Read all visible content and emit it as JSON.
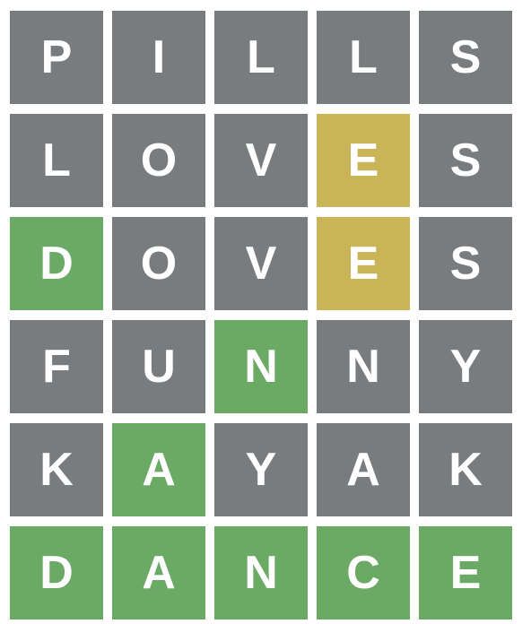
{
  "colors": {
    "absent": "#787c7e",
    "present": "#c9b458",
    "correct": "#6aaa64",
    "letter": "#ffffff",
    "background": "#ffffff"
  },
  "board": {
    "rows": [
      {
        "word": "PILLS",
        "tiles": [
          {
            "letter": "P",
            "state": "absent"
          },
          {
            "letter": "I",
            "state": "absent"
          },
          {
            "letter": "L",
            "state": "absent"
          },
          {
            "letter": "L",
            "state": "absent"
          },
          {
            "letter": "S",
            "state": "absent"
          }
        ]
      },
      {
        "word": "LOVES",
        "tiles": [
          {
            "letter": "L",
            "state": "absent"
          },
          {
            "letter": "O",
            "state": "absent"
          },
          {
            "letter": "V",
            "state": "absent"
          },
          {
            "letter": "E",
            "state": "present"
          },
          {
            "letter": "S",
            "state": "absent"
          }
        ]
      },
      {
        "word": "DOVES",
        "tiles": [
          {
            "letter": "D",
            "state": "correct"
          },
          {
            "letter": "O",
            "state": "absent"
          },
          {
            "letter": "V",
            "state": "absent"
          },
          {
            "letter": "E",
            "state": "present"
          },
          {
            "letter": "S",
            "state": "absent"
          }
        ]
      },
      {
        "word": "FUNNY",
        "tiles": [
          {
            "letter": "F",
            "state": "absent"
          },
          {
            "letter": "U",
            "state": "absent"
          },
          {
            "letter": "N",
            "state": "correct"
          },
          {
            "letter": "N",
            "state": "absent"
          },
          {
            "letter": "Y",
            "state": "absent"
          }
        ]
      },
      {
        "word": "KAYAK",
        "tiles": [
          {
            "letter": "K",
            "state": "absent"
          },
          {
            "letter": "A",
            "state": "correct"
          },
          {
            "letter": "Y",
            "state": "absent"
          },
          {
            "letter": "A",
            "state": "absent"
          },
          {
            "letter": "K",
            "state": "absent"
          }
        ]
      },
      {
        "word": "DANCE",
        "tiles": [
          {
            "letter": "D",
            "state": "correct"
          },
          {
            "letter": "A",
            "state": "correct"
          },
          {
            "letter": "N",
            "state": "correct"
          },
          {
            "letter": "C",
            "state": "correct"
          },
          {
            "letter": "E",
            "state": "correct"
          }
        ]
      }
    ]
  }
}
